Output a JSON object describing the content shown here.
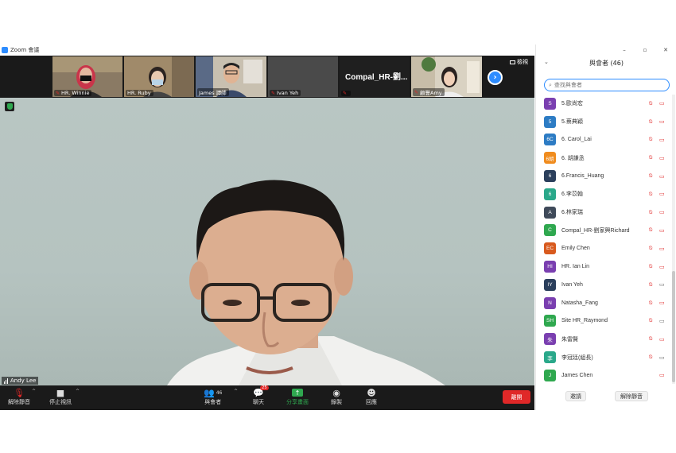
{
  "window": {
    "title": "Zoom 會議"
  },
  "window_controls": [
    "–",
    "▫",
    "✕"
  ],
  "thumbnails": [
    {
      "label": "HR. Winnie",
      "bg": "#8a7a64"
    },
    {
      "label": "HR. Ruby",
      "bg": "#a08a6a"
    },
    {
      "label": "James 譚師",
      "bg": "#c8c0b0"
    },
    {
      "label": "Ivan Yeh",
      "bg": "#4a4a4a"
    },
    {
      "label": "Compal_HR-劉...",
      "bg": "#1f1f1f"
    },
    {
      "label": "顧豐Amy",
      "bg": "#d9d2c2"
    }
  ],
  "view_label": "檢視",
  "speaker": {
    "name": "Andy Lee"
  },
  "toolbar": {
    "unmute": "解除靜音",
    "stop_video": "停止視訊",
    "participants": "與會者",
    "participants_count": "46",
    "chat": "聊天",
    "chat_badge": "25",
    "share": "分享畫面",
    "record": "錄製",
    "reactions": "回應",
    "leave": "離開"
  },
  "panel": {
    "title": "與會者 (46)",
    "search_placeholder": "查找與會者",
    "invite": "邀請",
    "unmute_all": "解除靜音"
  },
  "participants": [
    {
      "avatar": "S",
      "name": "5.歐尚宏",
      "color": "#7a3fb0",
      "cam": "off"
    },
    {
      "avatar": "5",
      "name": "5.蔡典穎",
      "color": "#2d7cc4",
      "cam": "off"
    },
    {
      "avatar": "6C",
      "name": "6. Carol_Lai",
      "color": "#2d7cc4",
      "cam": "off"
    },
    {
      "avatar": "6胡",
      "name": "6. 胡謙丞",
      "color": "#f08c1e",
      "cam": "off"
    },
    {
      "avatar": "6",
      "name": "6.Francis_Huang",
      "color": "#2b3f5c",
      "cam": "off"
    },
    {
      "avatar": "6",
      "name": "6.李苡翰",
      "color": "#2aa88a",
      "cam": "off"
    },
    {
      "avatar": "A",
      "name": "6.林家瑞",
      "color": "#3f4a5a",
      "cam": "off"
    },
    {
      "avatar": "C",
      "name": "Compal_HR-劉家興Richard",
      "color": "#2fa84f",
      "cam": "off"
    },
    {
      "avatar": "EC",
      "name": "Emily Chen",
      "color": "#d85a1e",
      "cam": "off"
    },
    {
      "avatar": "HI",
      "name": "HR. Ian Lin",
      "color": "#7a3fb0",
      "cam": "off"
    },
    {
      "avatar": "IY",
      "name": "Ivan Yeh",
      "color": "#2b3f5c",
      "cam": "on"
    },
    {
      "avatar": "N",
      "name": "Natasha_Fang",
      "color": "#7a3fb0",
      "cam": "off"
    },
    {
      "avatar": "SH",
      "name": "Site HR_Raymond",
      "color": "#2fa84f",
      "cam": "on"
    },
    {
      "avatar": "朱",
      "name": "朱雷賢",
      "color": "#7a3fb0",
      "cam": "off"
    },
    {
      "avatar": "李",
      "name": "李冠廷(組長)",
      "color": "#2aa88a",
      "cam": "on"
    },
    {
      "avatar": "J",
      "name": "James Chen",
      "color": "#2fa84f",
      "cam": "off"
    }
  ]
}
